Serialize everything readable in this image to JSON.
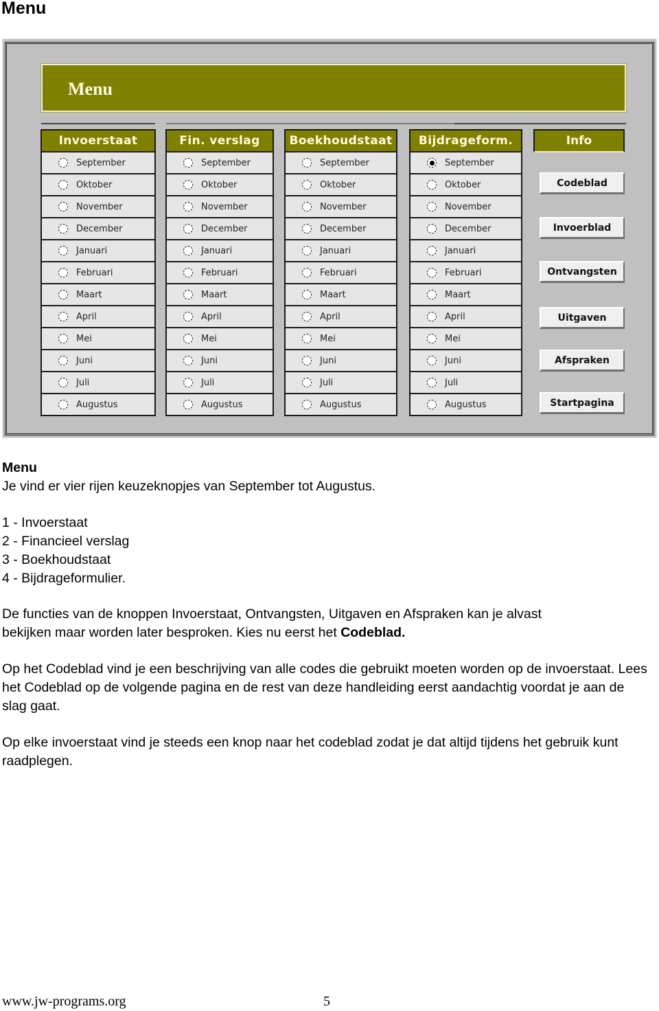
{
  "page": {
    "heading": "Menu",
    "footer_url": "www.jw-programs.org",
    "page_number": "5"
  },
  "app": {
    "title": "Menu",
    "colors": {
      "accent": "#808000",
      "panel": "#c0c0c0",
      "row": "#e6e6e6",
      "button": "#efefef"
    },
    "columns": [
      {
        "header": "Invoerstaat",
        "selected": null
      },
      {
        "header": "Fin. verslag",
        "selected": null
      },
      {
        "header": "Boekhoudstaat",
        "selected": null
      },
      {
        "header": "Bijdrageform.",
        "selected": "September"
      }
    ],
    "months": [
      "September",
      "Oktober",
      "November",
      "December",
      "Januari",
      "Februari",
      "Maart",
      "April",
      "Mei",
      "Juni",
      "Juli",
      "Augustus"
    ],
    "info": {
      "header": "Info",
      "buttons": [
        "Codeblad",
        "Invoerblad",
        "Ontvangsten",
        "Uitgaven",
        "Afspraken",
        "Startpagina"
      ]
    }
  },
  "text": {
    "section_title": "Menu",
    "intro": "Je vind er vier rijen keuzeknopjes van September tot Augustus.",
    "list": [
      "1 - Invoerstaat",
      "2 - Financieel verslag",
      "3 - Boekhoudstaat",
      "4 - Bijdrageformulier."
    ],
    "para1_line1": "De functies van de knoppen Invoerstaat, Ontvangsten, Uitgaven en  Afspraken kan je alvast",
    "para1_line2": "bekijken maar worden later besproken. Kies nu eerst het ",
    "para1_bold": "Codeblad.",
    "para2": "Op het Codeblad vind je een beschrijving van alle codes die gebruikt moeten worden op de invoerstaat. Lees het Codeblad op de volgende pagina en de rest van deze handleiding eerst aandachtig voordat je aan de slag gaat.",
    "para3": "Op elke invoerstaat vind je steeds een knop naar het codeblad zodat je dat altijd tijdens het gebruik kunt raadplegen."
  }
}
